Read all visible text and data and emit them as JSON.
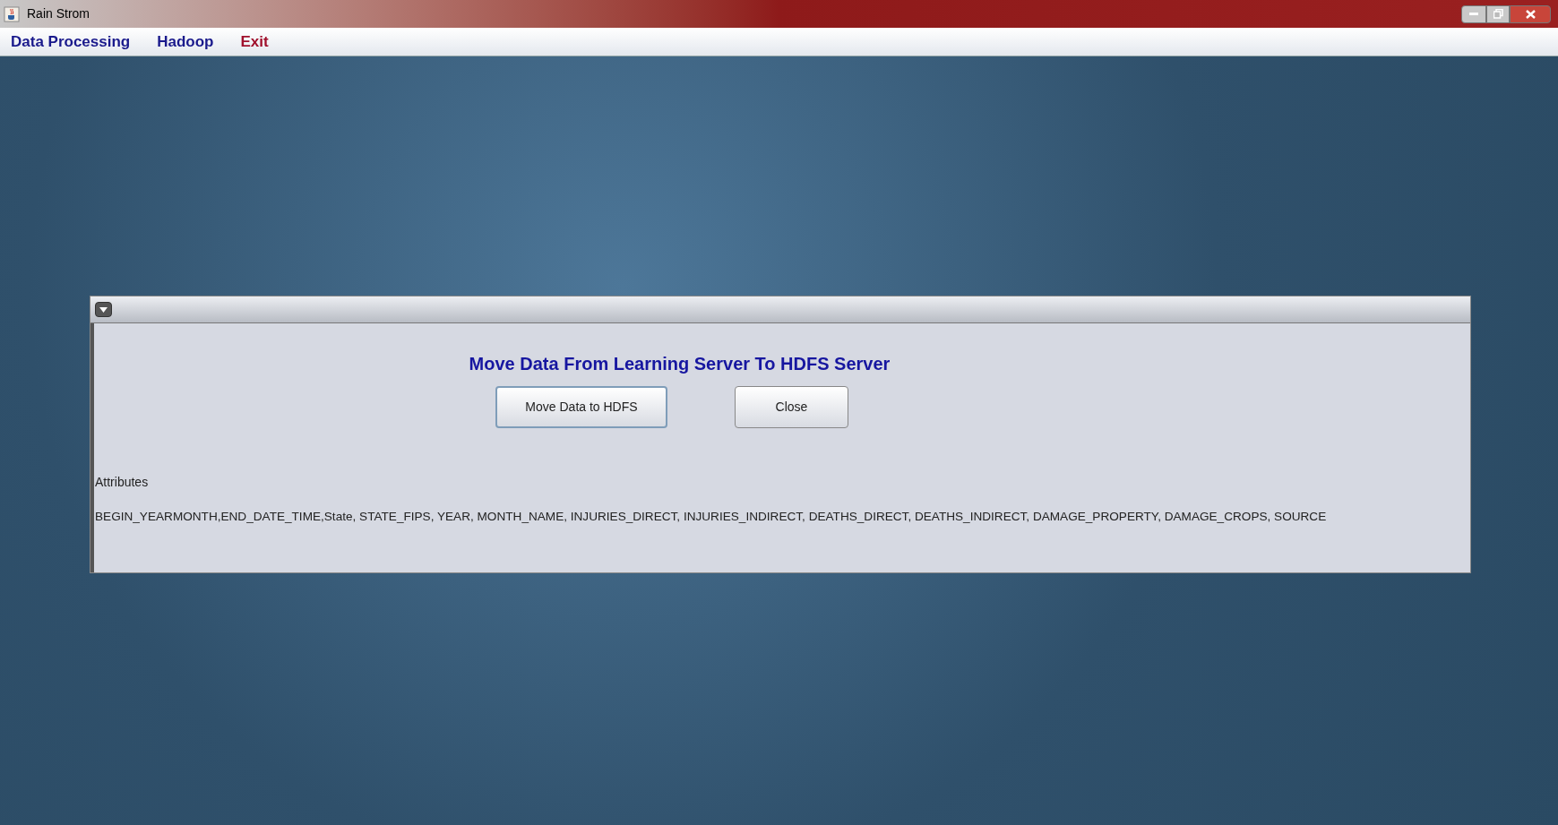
{
  "window": {
    "title": "Rain Strom"
  },
  "menu": [
    {
      "label": "Data Processing",
      "color": "#1a1a8c"
    },
    {
      "label": "Hadoop",
      "color": "#1a1a8c"
    },
    {
      "label": "Exit",
      "color": "#a0102c"
    }
  ],
  "dialog": {
    "heading": "Move Data From Learning Server To HDFS Server",
    "buttons": [
      "Move Data to HDFS",
      "Close"
    ],
    "attributes_label": "Attributes",
    "attributes_text": "BEGIN_YEARMONTH,END_DATE_TIME,State, STATE_FIPS, YEAR, MONTH_NAME, INJURIES_DIRECT, INJURIES_INDIRECT, DEATHS_DIRECT, DEATHS_INDIRECT, DAMAGE_PROPERTY, DAMAGE_CROPS, SOURCE"
  }
}
